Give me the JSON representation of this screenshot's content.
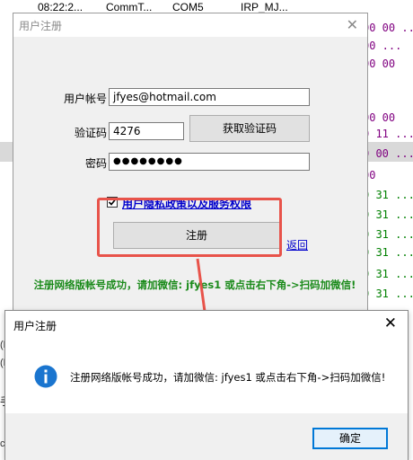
{
  "background": {
    "top_cells": [
      "08:22:2...",
      "CommT...",
      "COM5",
      "IRP_MJ..."
    ],
    "right_rows": [
      {
        "text": "00 00 ...",
        "color": "#800080"
      },
      {
        "text": "00 ...",
        "color": "#800080"
      },
      {
        "text": "00 00",
        "color": "#800080"
      },
      {
        "text": "00 00",
        "color": "#800080"
      },
      {
        "text": "0 11 ...",
        "color": "#800080"
      },
      {
        "text": "0 00 ...",
        "color": "#800080"
      },
      {
        "text": "00",
        "color": "#800080"
      },
      {
        "text": "0 31 ...",
        "color": "#008000"
      },
      {
        "text": "0 31 ...",
        "color": "#008000"
      },
      {
        "text": "0 31 ...",
        "color": "#008000"
      },
      {
        "text": "0 31 ...",
        "color": "#008000"
      },
      {
        "text": "0 31 ...",
        "color": "#008000"
      },
      {
        "text": "0 31 ...",
        "color": "#008000"
      }
    ],
    "left_fragments": [
      "(P",
      "(P",
      "手",
      "c"
    ]
  },
  "register_dialog": {
    "title": "用户注册",
    "close_glyph": "✕",
    "account_label": "用户帐号",
    "account_value": "jfyes@hotmail.com",
    "code_label": "验证码",
    "code_value": "4276",
    "get_code_button": "获取验证码",
    "password_label": "密码",
    "password_value": "●●●●●●●●",
    "privacy_link": "用户隐私政策以及服务权限",
    "register_button": "注册",
    "back_link": "返回",
    "success_message": "注册网络版帐号成功，请加微信: jfyes1 或点击右下角->扫码加微信!",
    "privacy_checked": true
  },
  "message_box": {
    "title": "用户注册",
    "close_glyph": "✕",
    "icon": "info-icon",
    "text": "注册网络版帐号成功，请加微信: jfyes1 或点击右下角->扫码加微信!",
    "ok_button": "确定"
  },
  "colors": {
    "annotation": "#e8534a",
    "success_text": "#1a8a1a",
    "link": "#0000cc",
    "info_icon": "#1a75cf"
  }
}
